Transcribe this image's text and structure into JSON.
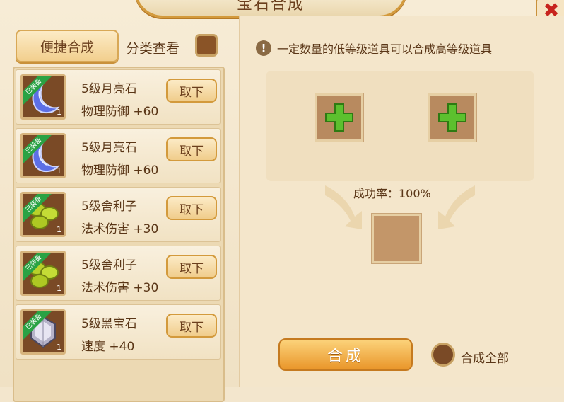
{
  "window": {
    "title": "宝石合成"
  },
  "left": {
    "quick_compose_label": "便捷合成",
    "category_label": "分类查看",
    "items": [
      {
        "badge": "已装备",
        "name": "5级月亮石",
        "attr": "物理防御 +60",
        "remove_label": "取下",
        "count": "1",
        "gem": "moonstone",
        "gem_color": "#5d6fe6"
      },
      {
        "badge": "已装备",
        "name": "5级月亮石",
        "attr": "物理防御 +60",
        "remove_label": "取下",
        "count": "1",
        "gem": "moonstone",
        "gem_color": "#5d6fe6"
      },
      {
        "badge": "已装备",
        "name": "5级舍利子",
        "attr": "法术伤害 +30",
        "remove_label": "取下",
        "count": "1",
        "gem": "sarira",
        "gem_color": "#b8d12a"
      },
      {
        "badge": "已装备",
        "name": "5级舍利子",
        "attr": "法术伤害 +30",
        "remove_label": "取下",
        "count": "1",
        "gem": "sarira",
        "gem_color": "#b8d12a"
      },
      {
        "badge": "已装备",
        "name": "5级黑宝石",
        "attr": "速度 +40",
        "remove_label": "取下",
        "count": "1",
        "gem": "black-gem",
        "gem_color": "#b6b3c9"
      }
    ]
  },
  "right": {
    "tip": "一定数量的低等级道具可以合成高等级道具",
    "success_rate": "成功率：100%",
    "compose_label": "合成",
    "compose_all_label": "合成全部"
  },
  "colors": {
    "accent": "#e9962a",
    "plus": "#5cc02e",
    "slot": "#b88a5f"
  }
}
